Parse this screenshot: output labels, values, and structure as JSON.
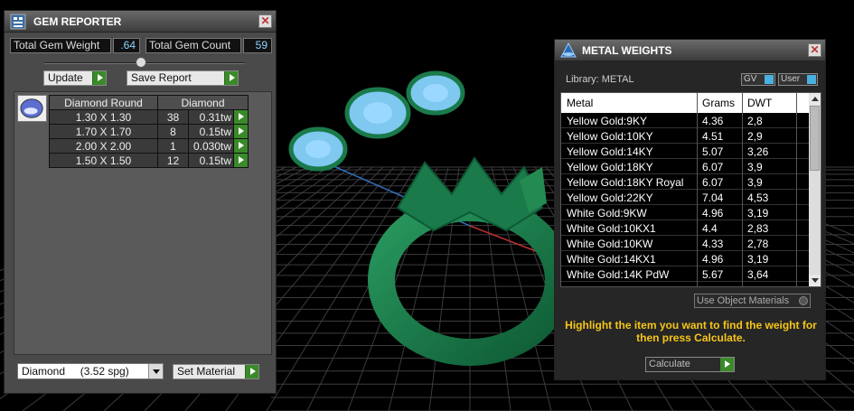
{
  "gem_reporter": {
    "title": "GEM REPORTER",
    "close_glyph": "✕",
    "total_weight_label": "Total Gem Weight",
    "total_weight_value": ".64",
    "total_count_label": "Total Gem Count",
    "total_count_value": "59",
    "update_label": "Update",
    "save_report_label": "Save Report",
    "table_headers": [
      "Diamond Round",
      "Diamond"
    ],
    "rows": [
      {
        "size": "1.30 X 1.30",
        "qty": "38",
        "tw": "0.31tw"
      },
      {
        "size": "1.70 X 1.70",
        "qty": "8",
        "tw": "0.15tw"
      },
      {
        "size": "2.00 X 2.00",
        "qty": "1",
        "tw": "0.030tw"
      },
      {
        "size": "1.50 X 1.50",
        "qty": "12",
        "tw": "0.15tw"
      }
    ],
    "material_select": "Diamond     (3.52 spg)",
    "set_material_label": "Set Material"
  },
  "metal_weights": {
    "title": "METAL WEIGHTS",
    "close_glyph": "✕",
    "library_label": "Library: METAL",
    "chip_gv": "GV",
    "chip_user": "User",
    "headers": [
      "Metal",
      "Grams",
      "DWT"
    ],
    "rows": [
      {
        "metal": "Yellow Gold:9KY",
        "grams": "4.36",
        "dwt": "2,8"
      },
      {
        "metal": "Yellow Gold:10KY",
        "grams": "4.51",
        "dwt": "2,9"
      },
      {
        "metal": "Yellow Gold:14KY",
        "grams": "5.07",
        "dwt": "3,26"
      },
      {
        "metal": "Yellow Gold:18KY",
        "grams": "6.07",
        "dwt": "3,9"
      },
      {
        "metal": "Yellow Gold:18KY Royal",
        "grams": "6.07",
        "dwt": "3,9"
      },
      {
        "metal": "Yellow Gold:22KY",
        "grams": "7.04",
        "dwt": "4,53"
      },
      {
        "metal": "White Gold:9KW",
        "grams": "4.96",
        "dwt": "3,19"
      },
      {
        "metal": "White Gold:10KX1",
        "grams": "4.4",
        "dwt": "2,83"
      },
      {
        "metal": "White Gold:10KW",
        "grams": "4.33",
        "dwt": "2,78"
      },
      {
        "metal": "White Gold:14KX1",
        "grams": "4.96",
        "dwt": "3,19"
      },
      {
        "metal": "White Gold:14K PdW",
        "grams": "5.67",
        "dwt": "3,64"
      }
    ],
    "use_object_materials": "Use Object Materials",
    "hint": "Highlight the item you want to find the weight for then press Calculate.",
    "calculate_label": "Calculate"
  },
  "colors": {
    "ring_green": "#1a7a4a",
    "gem_blue": "#7fc8f0",
    "grid": "#3a3a3a",
    "hint_yellow": "#f5c518"
  }
}
